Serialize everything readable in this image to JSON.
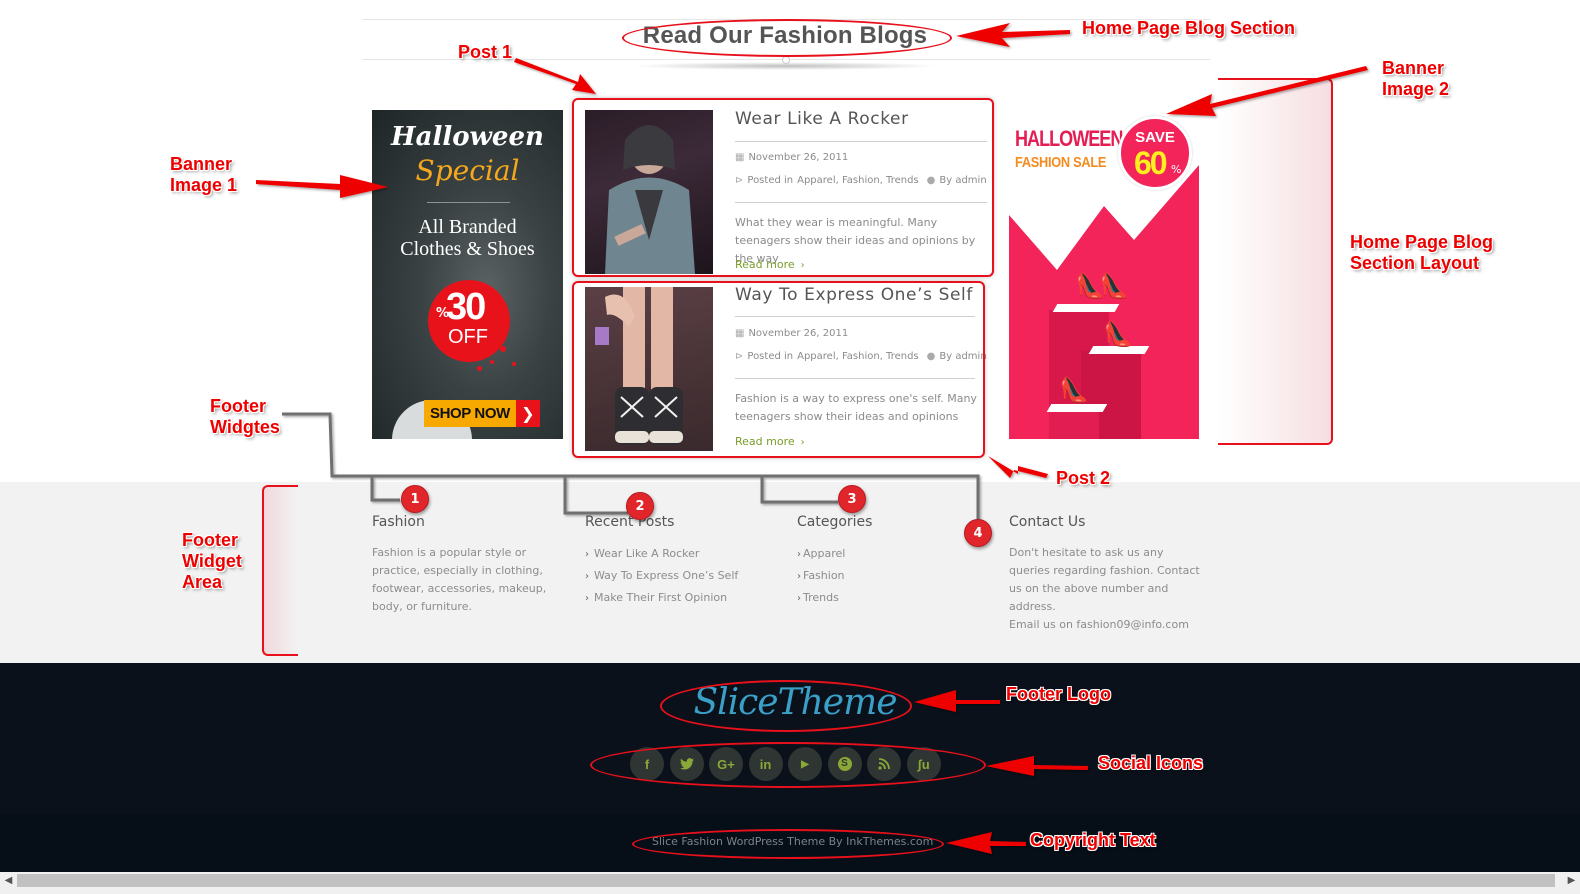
{
  "section": {
    "title": "Read Our Fashion Blogs"
  },
  "banner1": {
    "line1": "Halloween",
    "line2": "Special",
    "subtitle_line1": "All Branded",
    "subtitle_line2": "Clothes & Shoes",
    "discount": "30",
    "percent": "%",
    "off": "OFF",
    "cta": "SHOP NOW",
    "cta_arrow": "❯"
  },
  "banner2": {
    "line1": "HALLOWEEN",
    "line2": "FASHION SALE",
    "save": "SAVE",
    "discount": "60",
    "percent": "%"
  },
  "posts": [
    {
      "title": "Wear Like A Rocker",
      "date": "November 26, 2011",
      "posted_in_label": "Posted in",
      "categories": "Apparel, Fashion, Trends",
      "author_label": "By admin",
      "excerpt": "What they wear is meaningful. Many teenagers show their ideas and opinions by the way",
      "read_more": "Read more",
      "read_more_chevron": "›"
    },
    {
      "title": "Way To Express One’s Self",
      "date": "November 26, 2011",
      "posted_in_label": "Posted in",
      "categories": "Apparel, Fashion, Trends",
      "author_label": "By admin",
      "excerpt": "Fashion is a way to express one's self. Many teenagers show their ideas and opinions",
      "read_more": "Read more",
      "read_more_chevron": "›"
    }
  ],
  "footer_widgets": {
    "fashion": {
      "title": "Fashion",
      "text": "Fashion is a popular style or practice, especially in clothing, footwear, accessories, makeup, body, or furniture."
    },
    "recent_posts": {
      "title": "Recent Posts",
      "items": [
        "Wear Like A Rocker",
        "Way To Express One’s Self",
        "Make Their First Opinion"
      ]
    },
    "categories": {
      "title": "Categories",
      "items": [
        "Apparel",
        "Fashion",
        "Trends"
      ]
    },
    "contact": {
      "title": "Contact Us",
      "text": "Don't hesitate to ask us any queries regarding fashion. Contact us on the above number and address.",
      "email_line": "Email us on fashion09@info.com"
    }
  },
  "footer": {
    "logo": "SliceTheme",
    "social": [
      {
        "name": "facebook",
        "glyph": "f"
      },
      {
        "name": "twitter",
        "glyph": "🐦"
      },
      {
        "name": "google-plus",
        "glyph": "G+"
      },
      {
        "name": "linkedin",
        "glyph": "in"
      },
      {
        "name": "youtube",
        "glyph": "▶"
      },
      {
        "name": "skype",
        "glyph": "S"
      },
      {
        "name": "rss",
        "glyph": "◔"
      },
      {
        "name": "stumbleupon",
        "glyph": "ʃu"
      }
    ],
    "copyright": "Slice Fashion WordPress Theme By InkThemes.com"
  },
  "annotations": {
    "home_page_blog_section": "Home Page Blog Section",
    "post1": "Post 1",
    "post2": "Post 2",
    "banner_image_1": "Banner Image 1",
    "banner_image_2": "Banner Image 2",
    "blog_layout": "Home Page Blog Section Layout",
    "footer_widgets": "Footer Widgtes",
    "footer_widget_area": "Footer Widget Area",
    "footer_logo": "Footer Logo",
    "social_icons": "Social Icons",
    "copyright_text": "Copyright Text",
    "numbers": [
      "1",
      "2",
      "3",
      "4"
    ]
  },
  "colors": {
    "accent_green": "#7a9c2a",
    "annotation_red": "#e8101a",
    "footer_dark": "#0a111a",
    "widget_bg": "#f2f2f2"
  },
  "scrollbar": {
    "left_arrow": "◀",
    "right_arrow": "▶"
  }
}
